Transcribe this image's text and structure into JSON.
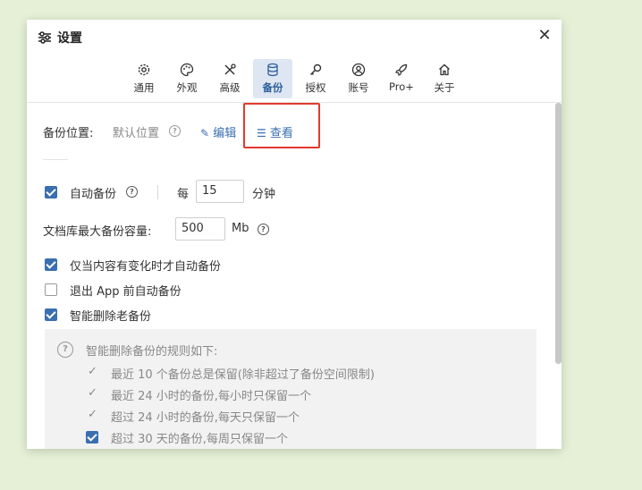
{
  "window": {
    "title": "设置"
  },
  "tabs": [
    {
      "label": "通用",
      "icon": "gear-icon",
      "active": false
    },
    {
      "label": "外观",
      "icon": "palette-icon",
      "active": false
    },
    {
      "label": "高级",
      "icon": "tools-icon",
      "active": false
    },
    {
      "label": "备份",
      "icon": "database-icon",
      "active": true
    },
    {
      "label": "授权",
      "icon": "key-icon",
      "active": false
    },
    {
      "label": "账号",
      "icon": "user-icon",
      "active": false
    },
    {
      "label": "Pro+",
      "icon": "rocket-icon",
      "active": false
    },
    {
      "label": "关于",
      "icon": "home-icon",
      "active": false
    }
  ],
  "backup_location": {
    "label": "备份位置:",
    "value": "默认位置",
    "edit_label": "编辑",
    "view_label": "查看"
  },
  "auto_backup": {
    "checked": true,
    "label": "自动备份",
    "every_label": "每",
    "interval_value": "15",
    "unit": "分钟"
  },
  "max_capacity": {
    "label": "文档库最大备份容量:",
    "value": "500",
    "unit": "Mb"
  },
  "options": [
    {
      "label": "仅当内容有变化时才自动备份",
      "checked": true
    },
    {
      "label": "退出 App 前自动备份",
      "checked": false
    },
    {
      "label": "智能删除老备份",
      "checked": true
    }
  ],
  "rules": {
    "title": "智能删除备份的规则如下:",
    "items": [
      {
        "text": "最近 10 个备份总是保留(除非超过了备份空间限制)",
        "checkbox": false
      },
      {
        "text": "最近 24 小时的备份,每小时只保留一个",
        "checkbox": false
      },
      {
        "text": "超过 24 小时的备份,每天只保留一个",
        "checkbox": false
      },
      {
        "text": "超过 30 天的备份,每周只保留一个",
        "checkbox": true
      }
    ]
  },
  "colors": {
    "accent": "#3a6fb0",
    "highlight": "#e03b2f",
    "background": "#e5f0d6"
  }
}
